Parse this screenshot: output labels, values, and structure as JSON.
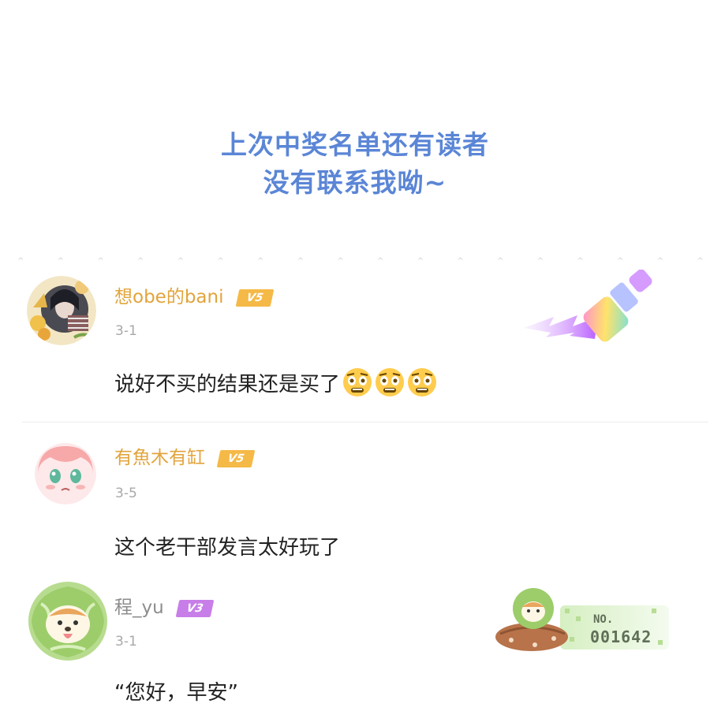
{
  "headline": {
    "line1": "上次中奖名单还有读者",
    "line2": "没有联系我呦~",
    "color": "#5b86d6"
  },
  "comments": [
    {
      "username": "想obe的bani",
      "username_color": "#e2a43c",
      "badge": "V5",
      "badge_color": "#f5b947",
      "date": "3-1",
      "text": "说好不买的结果还是买了",
      "emojis": [
        "astonished-face-emoji",
        "astonished-face-emoji",
        "astonished-face-emoji"
      ],
      "decoration": "paintbrush-badge-icon"
    },
    {
      "username": "有魚木有缸",
      "username_color": "#e2a43c",
      "badge": "V5",
      "badge_color": "#f5b947",
      "date": "3-5",
      "text": "这个老干部发言太好玩了"
    },
    {
      "username": "程_yu",
      "username_color": "#8d8d8d",
      "badge": "V3",
      "badge_color": "#c77ee8",
      "date": "3-1",
      "text": "“您好，早安”",
      "decoration": "cabbage-dog-fan-card",
      "card_number_label": "NO.",
      "card_number": "001642"
    }
  ]
}
